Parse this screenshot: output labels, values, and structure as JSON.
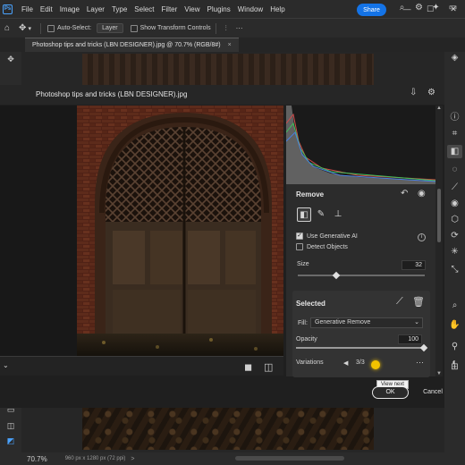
{
  "app": {
    "logo": "Ps"
  },
  "menu": [
    "File",
    "Edit",
    "Image",
    "Layer",
    "Type",
    "Select",
    "Filter",
    "View",
    "Plugins",
    "Window",
    "Help"
  ],
  "window_controls": {
    "minimize": "—",
    "maximize": "☐",
    "close": "✕"
  },
  "options_bar": {
    "auto_select_label": "Auto-Select:",
    "auto_select_target": "Layer",
    "show_transform_label": "Show Transform Controls",
    "share_label": "Share"
  },
  "document_tab": {
    "title": "Photoshop tips and tricks (LBN DESIGNER).jpg @ 70.7% (RGB/8#)",
    "close": "×"
  },
  "modal": {
    "title": "Photoshop tips and tricks (LBN DESIGNER).jpg",
    "remove_panel": {
      "title": "Remove",
      "use_generative_ai_label": "Use Generative AI",
      "use_generative_ai_checked": true,
      "detect_objects_label": "Detect Objects",
      "detect_objects_checked": false,
      "size_label": "Size",
      "size_value": "32",
      "size_fraction": 0.3
    },
    "selected_panel": {
      "title": "Selected",
      "fill_label": "Fill:",
      "fill_value": "Generative Remove",
      "opacity_label": "Opacity",
      "opacity_value": "100",
      "variations_label": "Variations",
      "variations_count": "3/3"
    },
    "tooltip": "View next",
    "ok_label": "OK",
    "cancel_label": "Cancel"
  },
  "status_bar": {
    "zoom": "70.7%",
    "dimensions": "960 px x 1280 px (72 ppi)",
    "chevron": ">"
  },
  "colors": {
    "accent": "#1473e6",
    "panel": "#2c2c2c",
    "cursor": "#f2c200"
  }
}
